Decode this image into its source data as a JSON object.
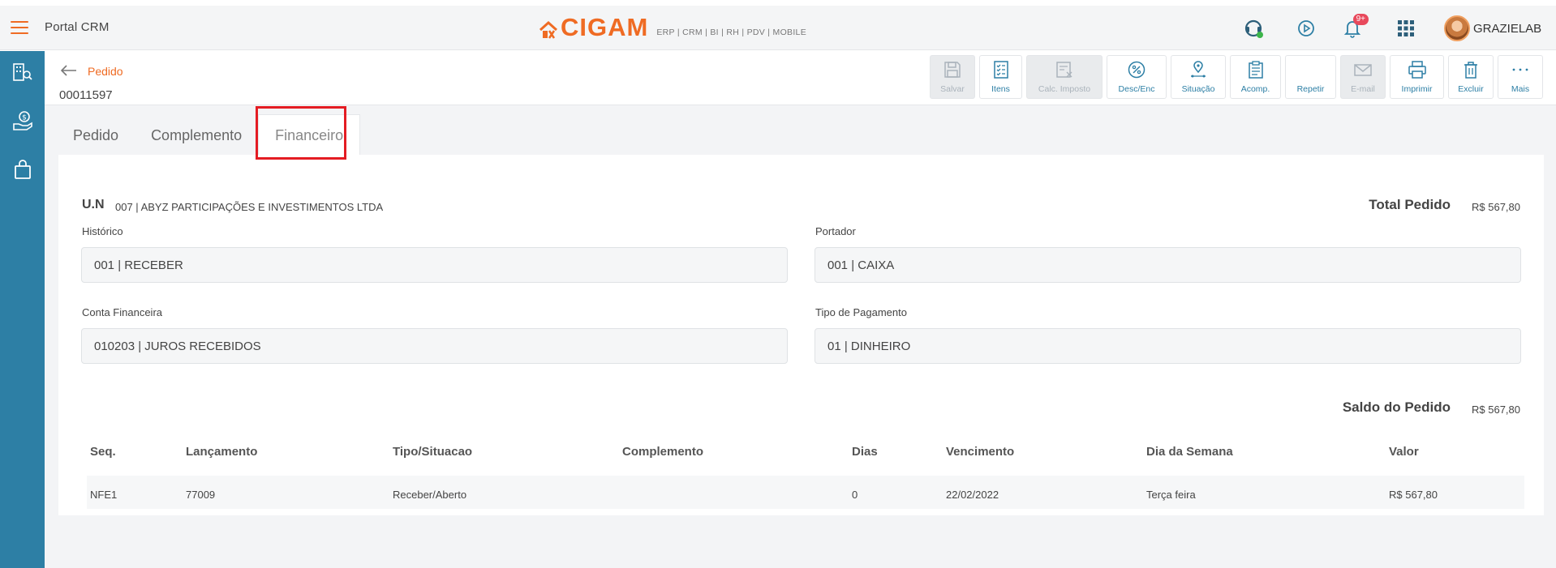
{
  "header": {
    "portal_title": "Portal CRM",
    "logo_text": "CIGAM",
    "logo_sub": "ERP | CRM | BI | RH | PDV | MOBILE",
    "notification_count": "9+",
    "user_name": "GRAZIELAB",
    "accent": "#ef6b23"
  },
  "sidebar": {
    "color": "#2d7fa5",
    "items": [
      "building-search-icon",
      "money-hand-icon",
      "shopping-bag-icon"
    ]
  },
  "page": {
    "breadcrumb": "Pedido",
    "order_number": "00011597"
  },
  "toolbar": [
    {
      "label": "Salvar",
      "icon": "save-icon",
      "disabled": true
    },
    {
      "label": "Itens",
      "icon": "checklist-icon",
      "disabled": false
    },
    {
      "label": "Calc. Imposto",
      "icon": "tax-calc-icon",
      "disabled": true
    },
    {
      "label": "Desc/Enc",
      "icon": "percent-icon",
      "disabled": false
    },
    {
      "label": "Situação",
      "icon": "location-route-icon",
      "disabled": false
    },
    {
      "label": "Acomp.",
      "icon": "clipboard-icon",
      "disabled": false
    },
    {
      "label": "Repetir",
      "icon": "",
      "disabled": false
    },
    {
      "label": "E-mail",
      "icon": "mail-icon",
      "disabled": true
    },
    {
      "label": "Imprimir",
      "icon": "print-icon",
      "disabled": false
    },
    {
      "label": "Excluir",
      "icon": "trash-icon",
      "disabled": false
    },
    {
      "label": "Mais",
      "icon": "more-dots-icon",
      "disabled": false
    }
  ],
  "tabs": [
    {
      "label": "Pedido",
      "active": false
    },
    {
      "label": "Complemento",
      "active": false
    },
    {
      "label": "Financeiro",
      "active": true
    }
  ],
  "financeiro": {
    "un_label": "U.N",
    "un_value": "007 | ABYZ PARTICIPAÇÕES E INVESTIMENTOS LTDA",
    "total_label": "Total Pedido",
    "total_value": "R$ 567,80",
    "historico_label": "Histórico",
    "historico_value": "001 | RECEBER",
    "portador_label": "Portador",
    "portador_value": "001 | CAIXA",
    "conta_label": "Conta Financeira",
    "conta_value": "010203 | JUROS RECEBIDOS",
    "tipo_pagamento_label": "Tipo de Pagamento",
    "tipo_pagamento_value": "01 | DINHEIRO",
    "saldo_label": "Saldo do Pedido",
    "saldo_value": "R$ 567,80"
  },
  "table": {
    "headers": [
      "Seq.",
      "Lançamento",
      "Tipo/Situacao",
      "Complemento",
      "Dias",
      "Vencimento",
      "Dia da Semana",
      "Valor"
    ],
    "rows": [
      [
        "NFE1",
        "77009",
        "Receber/Aberto",
        "",
        "0",
        "22/02/2022",
        "Terça feira",
        "R$ 567,80"
      ]
    ]
  }
}
